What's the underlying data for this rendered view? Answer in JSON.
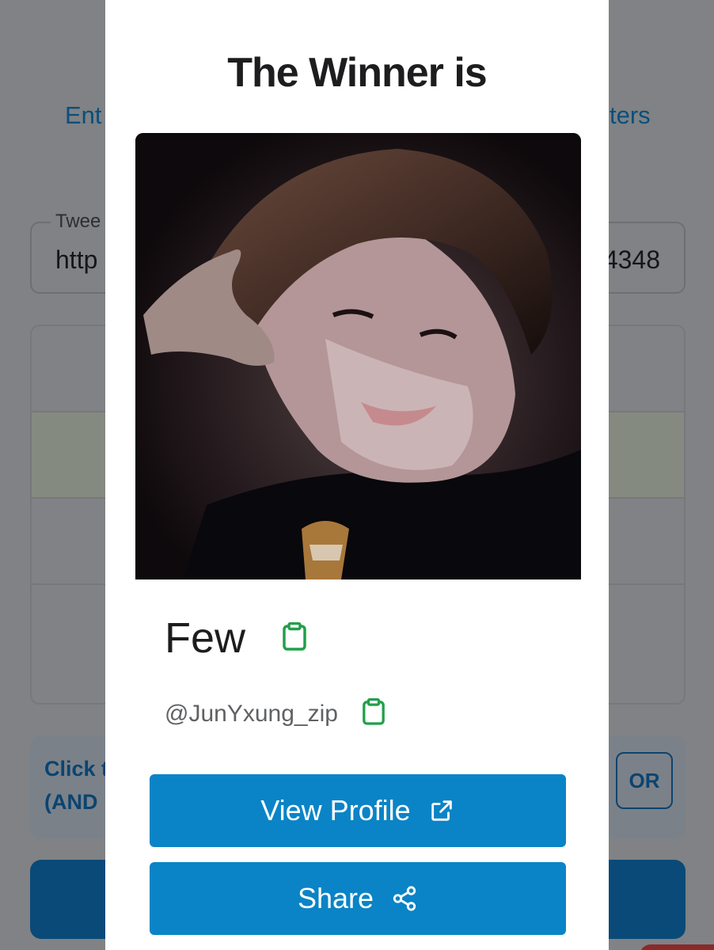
{
  "background": {
    "link_left": "Ent",
    "link_right": "ters",
    "tweet_field": {
      "label": "Twee",
      "value_start": "http",
      "value_end": "4348"
    },
    "hint_line1": "Click t",
    "hint_line2": "(AND",
    "or_label": "OR"
  },
  "modal": {
    "title": "The Winner is",
    "winner": {
      "name": "Few",
      "handle": "@JunYxung_zip"
    },
    "buttons": {
      "view_profile": "View Profile",
      "share": "Share"
    }
  },
  "colors": {
    "primary_button": "#0a84c6",
    "copy_icon": "#21a04a",
    "overlay": "#808285"
  },
  "icons": {
    "copy": "clipboard-icon",
    "external": "external-link-icon",
    "share": "share-icon"
  }
}
